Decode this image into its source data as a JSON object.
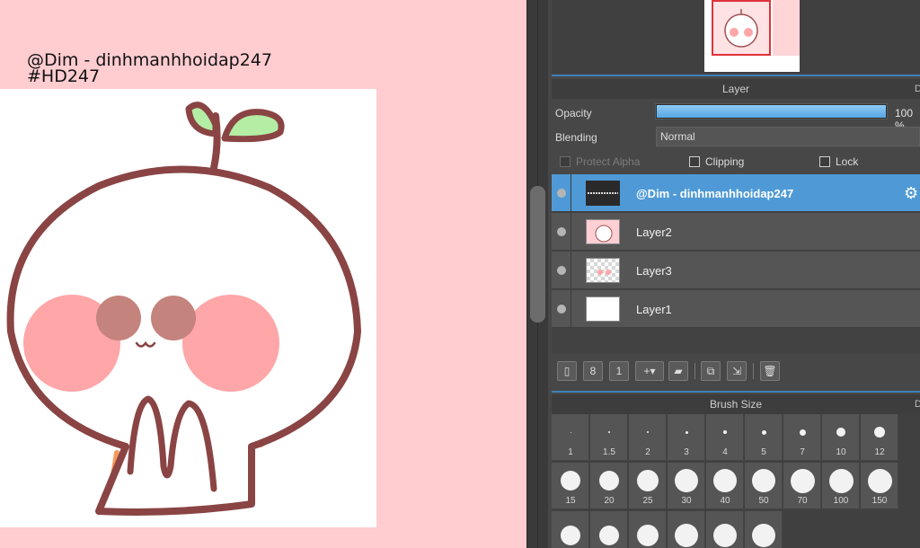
{
  "canvas": {
    "watermark_line1": "@Dim - dinhmanhhoidap247",
    "watermark_line2": "#HD247",
    "colors": {
      "background": "#ffccd0",
      "outline": "#8a4444",
      "cheek": "#ffa6a8",
      "eye": "#c4837c",
      "leaf": "#b4eda4",
      "highlight": "#f69a5a"
    }
  },
  "layer_panel": {
    "title": "Layer",
    "corner_glyph": "D",
    "opacity_label": "Opacity",
    "opacity_value": "100 %",
    "opacity_fraction": 1.0,
    "blending_label": "Blending",
    "blending_value": "Normal",
    "protect_alpha_label": "Protect Alpha",
    "clipping_label": "Clipping",
    "lock_label": "Lock",
    "layers": [
      {
        "name": "@Dim - dinhmanhhoidap247",
        "selected": true
      },
      {
        "name": "Layer2",
        "selected": false
      },
      {
        "name": "Layer3",
        "selected": false
      },
      {
        "name": "Layer1",
        "selected": false
      }
    ]
  },
  "brush_panel": {
    "title": "Brush Size",
    "corner_glyph": "D",
    "sizes": [
      "1",
      "1.5",
      "2",
      "3",
      "4",
      "5",
      "7",
      "10",
      "12",
      "15",
      "20",
      "25",
      "30",
      "40",
      "50",
      "70",
      "100",
      "150",
      "",
      "",
      "",
      "",
      "",
      ""
    ]
  },
  "icons": [
    "eye-icon",
    "gear-icon",
    "new-layer-icon",
    "copy-layer-icon",
    "number-layer-icon",
    "add-layer-icon",
    "folder-icon",
    "duplicate-icon",
    "merge-icon",
    "trash-icon"
  ],
  "colors": {
    "accent": "#4f9ad6",
    "panel": "#474747",
    "opacity_fill": "#57a6e4"
  }
}
